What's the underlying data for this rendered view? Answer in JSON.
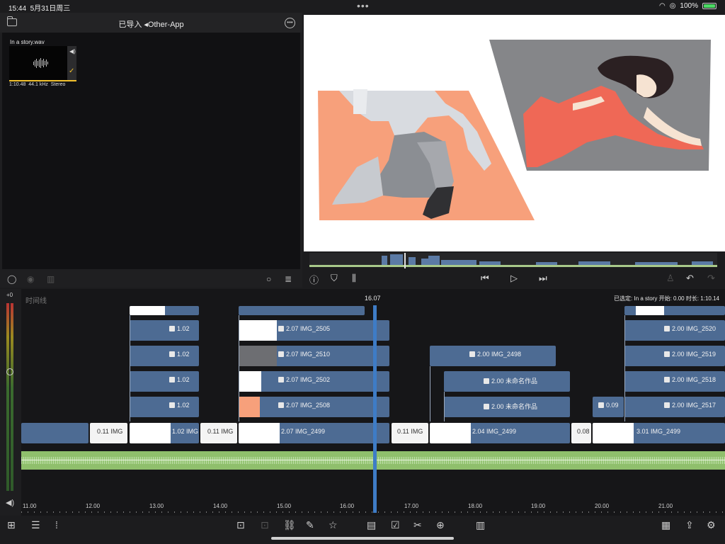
{
  "statusbar": {
    "time": "15:44",
    "date": "5月31日周三",
    "battery": "100%"
  },
  "browser": {
    "title": "已导入 ◂Other-App",
    "clip": {
      "name": "In a story.wav",
      "duration": "1:10.48",
      "sample_rate": "44.1 kHz",
      "channels": "Stereo"
    }
  },
  "timeline": {
    "label": "时间线",
    "playhead_time": "16.07",
    "selection_info": "已选定: In a story 开始: 0.00 时长: 1:10.14",
    "ruler": [
      "11.00",
      "12.00",
      "13.00",
      "14.00",
      "15.00",
      "16.00",
      "17.00",
      "18.00",
      "19.00",
      "20.00",
      "21.00"
    ],
    "meter_zero": "+0",
    "clips": {
      "a1": "1.02",
      "a2": "1.02",
      "a3": "1.02",
      "a4": "1.02",
      "b1": "2.07   IMG_2505",
      "b2": "2.07   IMG_2510",
      "b3": "2.07   IMG_2502",
      "b4": "2.07   IMG_2508",
      "c1": "2.00   IMG_2498",
      "c2": "2.00   未命名作品",
      "c3": "2.00   未命名作品",
      "d0": "0.09",
      "e1": "2.00   IMG_2520",
      "e2": "2.00   IMG_2519",
      "e3": "2.00   IMG_2518",
      "e4": "2.00   IMG_2517",
      "p1": "0.11   IMG",
      "p2": "1.02   IMG",
      "p3": "0.11   IMG",
      "p4": "2.07   IMG_2499",
      "p5": "0.11   IMG",
      "p6": "2.04   IMG_2499",
      "p7": "0.08",
      "p8": "3.01   IMG_2499"
    }
  }
}
